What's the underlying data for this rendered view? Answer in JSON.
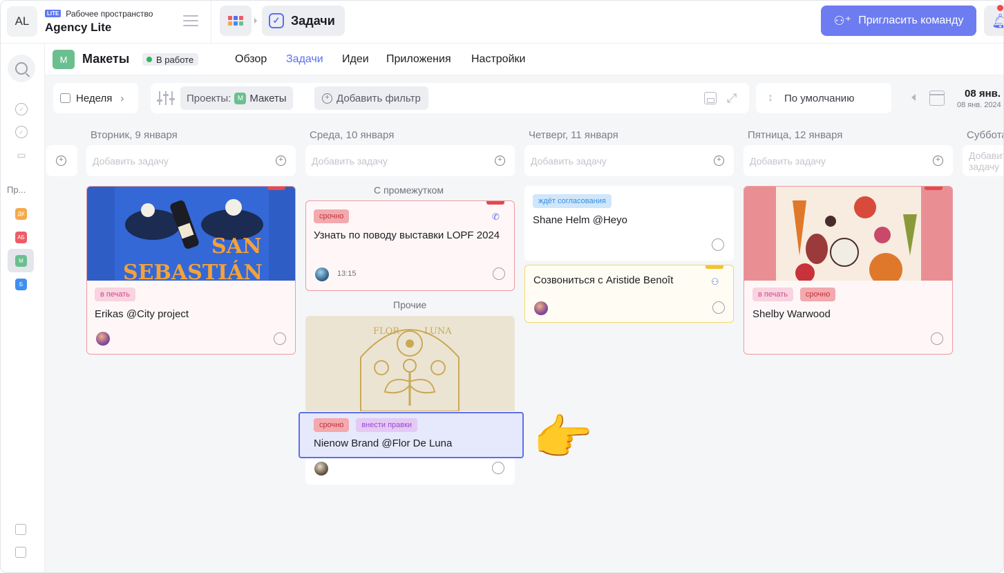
{
  "workspace": {
    "initials": "AL",
    "badge": "LITE",
    "label": "Рабочее пространство",
    "name": "Agency Lite"
  },
  "breadcrumb": {
    "current": "Задачи"
  },
  "invite": {
    "label": "Пригласить команду"
  },
  "sidebar": {
    "section_label": "Пр...",
    "projects": [
      {
        "initials": "ДК",
        "color": "#f4a94a"
      },
      {
        "initials": "АБ",
        "color": "#ef5a66"
      },
      {
        "initials": "М",
        "color": "#6bbf8e"
      },
      {
        "initials": "Б",
        "color": "#3f8ff0"
      }
    ]
  },
  "project": {
    "initial": "М",
    "name": "Макеты",
    "status": "В работе",
    "tabs": [
      "Обзор",
      "Задачи",
      "Идеи",
      "Приложения",
      "Настройки"
    ],
    "active_tab": "Задачи"
  },
  "toolbar": {
    "period": "Неделя",
    "filter_label": "Проекты:",
    "filter_chip_initial": "М",
    "filter_value": "Макеты",
    "add_filter": "Добавить фильтр",
    "sort": "По умолчанию",
    "date_main": "08 янв.",
    "date_sub": "08 янв. 2024"
  },
  "board": {
    "add_task_placeholder": "Добавить задачу",
    "columns": [
      {
        "title": "Вторник, 9 января"
      },
      {
        "title": "Среда, 10 января",
        "groups": [
          "С промежутком",
          "Прочие"
        ]
      },
      {
        "title": "Четверг, 11 января"
      },
      {
        "title": "Пятница, 12 января"
      },
      {
        "title": "Суббота"
      }
    ],
    "cards": {
      "erikas": {
        "badges": [
          "в печать"
        ],
        "title": "Erikas @City project"
      },
      "lopf": {
        "badges": [
          "срочно"
        ],
        "title": "Узнать по поводу выставки LOPF 2024",
        "time": "13:15",
        "icon": "phone-icon"
      },
      "flor": {
        "badges": [
          "срочно",
          "внести правки"
        ],
        "title": "Nienow Brand @Flor De Luna"
      },
      "shane": {
        "badges": [
          "ждёт согласования"
        ],
        "title": "Shane Helm @Heyo"
      },
      "aristide": {
        "title": "Созвониться с Aristide Benoît",
        "icon": "people-icon"
      },
      "shelby": {
        "badges": [
          "в печать",
          "срочно"
        ],
        "title": "Shelby Warwood"
      }
    }
  },
  "colors": {
    "accent": "#5a6ff0",
    "urgent": "#e5484d",
    "card_border_red": "#ec9aa0",
    "card_border_yellow": "#f3d66a"
  }
}
